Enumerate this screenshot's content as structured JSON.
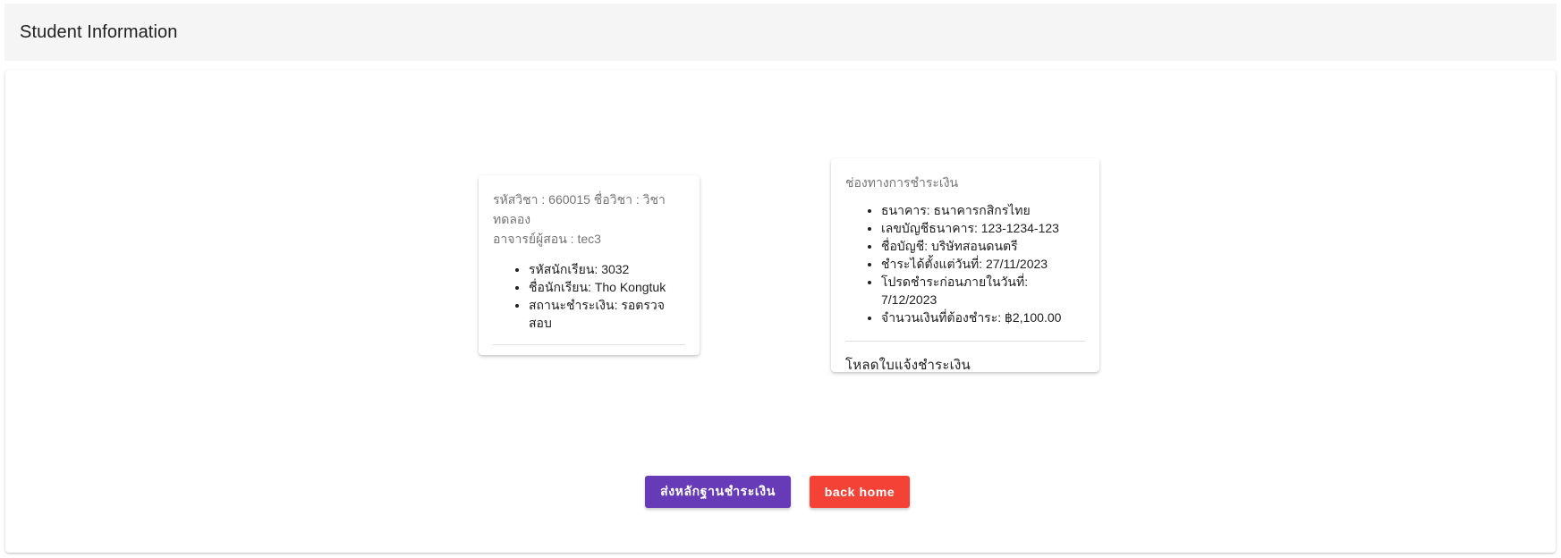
{
  "header": {
    "title": "Student Information"
  },
  "student_card": {
    "subtitle_line1": "รหัสวิชา : 660015 ชื่อวิชา : วิชาทดลอง",
    "subtitle_line2": "อาจารย์ผู้สอน : tec3",
    "items": [
      "รหัสนักเรียน: 3032",
      "ชื่อนักเรียน: Tho Kongtuk",
      "สถานะชำระเงิน: รอตรวจสอบ"
    ]
  },
  "payment_card": {
    "subtitle": "ช่องทางการชำระเงิน",
    "items": [
      "ธนาคาร: ธนาคารกสิกรไทย",
      "เลขบัญชีธนาคาร: 123-1234-123",
      "ชื่อบัญชี: บริษัทสอนดนตรี",
      "ชำระได้ตั้งแต่วันที่: 27/11/2023",
      "โปรดชำระก่อนภายในวันที่: 7/12/2023",
      "จำนวนเงินที่ต้องชำระ: ฿2,100.00"
    ],
    "action_label": "โหลดใบแจ้งชำระเงิน"
  },
  "buttons": {
    "submit_proof_label": "ส่งหลักฐานชำระเงิน",
    "back_home_label": "back home"
  },
  "colors": {
    "primary": "#673ab7",
    "danger": "#f44336",
    "header_bg": "#f5f5f5"
  }
}
